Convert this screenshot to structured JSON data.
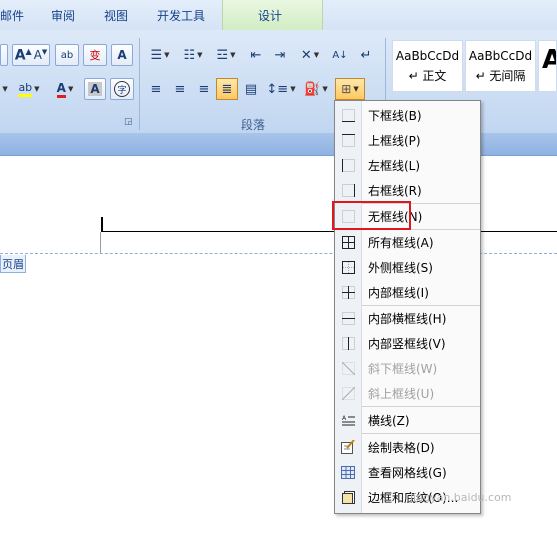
{
  "tabs": [
    "邮件",
    "审阅",
    "视图",
    "开发工具",
    "设计"
  ],
  "ribbon": {
    "font_buttons": [
      "A",
      "A",
      "ab",
      "wén 变",
      "A"
    ],
    "paragraph_group_label": "段落",
    "styles": [
      {
        "preview": "AaBbCcDd",
        "name": "↵ 正文"
      },
      {
        "preview": "AaBbCcDd",
        "name": "↵ 无间隔"
      },
      {
        "preview": "A",
        "name": ""
      }
    ],
    "accent_color": "#ffc860"
  },
  "document": {
    "header_label": "页眉"
  },
  "border_menu": {
    "items": [
      {
        "label": "下框线(B)",
        "icon": "bottom-border-icon",
        "enabled": true
      },
      {
        "label": "上框线(P)",
        "icon": "top-border-icon",
        "enabled": true
      },
      {
        "label": "左框线(L)",
        "icon": "left-border-icon",
        "enabled": true
      },
      {
        "label": "右框线(R)",
        "icon": "right-border-icon",
        "enabled": true
      },
      {
        "label": "无框线(N)",
        "icon": "no-border-icon",
        "enabled": true,
        "highlighted": true
      },
      {
        "label": "所有框线(A)",
        "icon": "all-borders-icon",
        "enabled": true
      },
      {
        "label": "外侧框线(S)",
        "icon": "outside-borders-icon",
        "enabled": true
      },
      {
        "label": "内部框线(I)",
        "icon": "inside-borders-icon",
        "enabled": true
      },
      {
        "label": "内部横框线(H)",
        "icon": "inside-horizontal-border-icon",
        "enabled": true
      },
      {
        "label": "内部竖框线(V)",
        "icon": "inside-vertical-border-icon",
        "enabled": true
      },
      {
        "label": "斜下框线(W)",
        "icon": "diagonal-down-border-icon",
        "enabled": false
      },
      {
        "label": "斜上框线(U)",
        "icon": "diagonal-up-border-icon",
        "enabled": false
      },
      {
        "label": "横线(Z)",
        "icon": "horizontal-line-icon",
        "enabled": true
      },
      {
        "label": "绘制表格(D)",
        "icon": "draw-table-icon",
        "enabled": true
      },
      {
        "label": "查看网格线(G)",
        "icon": "view-gridlines-icon",
        "enabled": true
      },
      {
        "label": "边框和底纹(O)...",
        "icon": "borders-shading-icon",
        "enabled": true
      }
    ],
    "highlight_color": "#e0171c"
  },
  "watermark": "jingyan.baidu.com"
}
